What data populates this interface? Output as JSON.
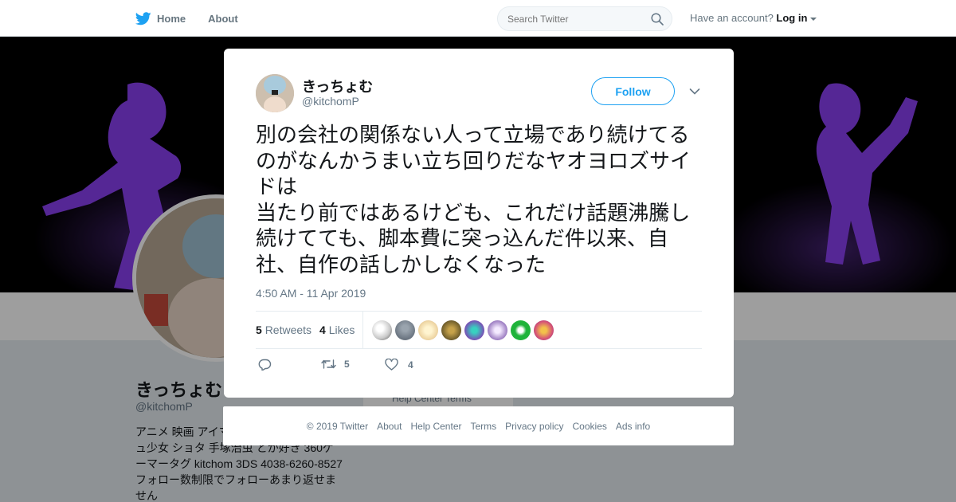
{
  "nav": {
    "home_label": "Home",
    "about_label": "About",
    "search_placeholder": "Search Twitter",
    "account_prompt": "Have an account?",
    "login_label": "Log in"
  },
  "profile": {
    "name": "きっちょむ",
    "handle": "@kitchomP",
    "bio": "アニメ 映画 アイマス 東方 特撮 Vtuber ショタ 少年 少女 魔法少女 ュ少女 ショタ 手塚治虫 とか好き 360ケーマータグ kitchom 3DS 4038-6260-8527 フォロー数制限でフォローあまり返せません",
    "bio_lines": [
      "アニメ 映画 アイマ",
      "ュ少女 ショタ 手塚治虫 とか好き 360ゲ",
      "ーマータグ kitchom 3DS 4038-6260-8527",
      "フォロー数制限でフォローあまり返せま",
      "せん"
    ],
    "card_text": "Help Center   Terms"
  },
  "tweet": {
    "author_name": "きっちょむ",
    "author_handle": "@kitchomP",
    "follow_label": "Follow",
    "text": "別の会社の関係ない人って立場であり続けてるのがなんかうまい立ち回りだなヤオヨロズサイドは\n当たり前ではあるけども、これだけ話題沸騰し続けてても、脚本費に突っ込んだ件以来、自社、自作の話しかしなくなった",
    "timestamp": "4:50 AM - 11 Apr 2019",
    "retweets_count": "5",
    "retweets_label": "Retweets",
    "likes_count": "4",
    "likes_label": "Likes",
    "reply_count": "",
    "retweet_action_count": "5",
    "like_action_count": "4"
  },
  "likers": [
    {
      "icon": "liker-avatar-1",
      "color": "#c8c8c8"
    },
    {
      "icon": "liker-avatar-2",
      "color": "#6a7480"
    },
    {
      "icon": "liker-avatar-3",
      "color": "#f0d9a8"
    },
    {
      "icon": "liker-avatar-4",
      "color": "#6b5a2a"
    },
    {
      "icon": "liker-avatar-5",
      "color": "#7a4db5"
    },
    {
      "icon": "liker-avatar-6",
      "color": "#9a7ac0"
    },
    {
      "icon": "liker-avatar-7",
      "color": "#1fb33a"
    },
    {
      "icon": "liker-avatar-8",
      "color": "#d24a7a"
    }
  ],
  "footer": {
    "links": [
      "© 2019 Twitter",
      "About",
      "Help Center",
      "Terms",
      "Privacy policy",
      "Cookies",
      "Ads info"
    ]
  },
  "colors": {
    "brand_blue": "#1da1f2",
    "text_dark": "#14171a",
    "text_gray": "#657786",
    "banner_purple": "#8a3ff0"
  }
}
